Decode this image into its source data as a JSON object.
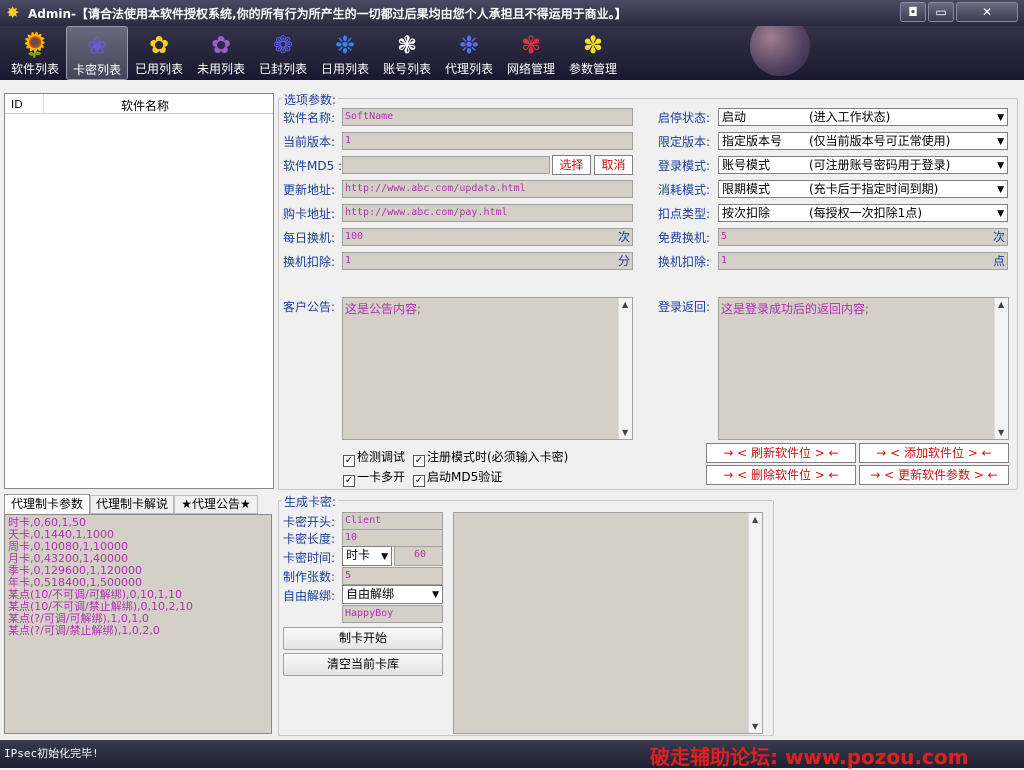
{
  "title": "Admin-【请合法使用本软件授权系统,你的所有行为所产生的一切都过后果均由您个人承担且不得运用于商业。】",
  "window_buttons": {
    "restore": "◘",
    "minimize": "▭",
    "close": "✕"
  },
  "toolbar": [
    {
      "label": "软件列表",
      "icon": "🌻",
      "color": "#f0c030"
    },
    {
      "label": "卡密列表",
      "icon": "❀",
      "color": "#6a5adc"
    },
    {
      "label": "已用列表",
      "icon": "✿",
      "color": "#f5d020"
    },
    {
      "label": "未用列表",
      "icon": "✿",
      "color": "#9a60d0"
    },
    {
      "label": "已封列表",
      "icon": "❁",
      "color": "#5a60e0"
    },
    {
      "label": "日用列表",
      "icon": "❉",
      "color": "#3a80f0"
    },
    {
      "label": "账号列表",
      "icon": "❃",
      "color": "#ffffff"
    },
    {
      "label": "代理列表",
      "icon": "❉",
      "color": "#5a70f0"
    },
    {
      "label": "网络管理",
      "icon": "✾",
      "color": "#e03040"
    },
    {
      "label": "参数管理",
      "icon": "✽",
      "color": "#f0e020"
    }
  ],
  "software_list": {
    "col_id": "ID",
    "col_name": "软件名称"
  },
  "tabs": [
    "代理制卡参数",
    "代理制卡解说",
    "★代理公告★"
  ],
  "agent_params": [
    "时卡,0,60,1,50",
    "天卡,0,1440,1,1000",
    "周卡,0,10080,1,10000",
    "月卡,0,43200,1,40000",
    "季卡,0,129600,1,120000",
    "年卡,0,518400,1,500000",
    "某点(10/不可调/可解绑),0,10,1,10",
    "某点(10/不可调/禁止解绑),0,10,2,10",
    "某点(?/可调/可解绑),1,0,1,0",
    "某点(?/可调/禁止解绑),1,0,2,0"
  ],
  "options": {
    "group_title": "选项参数:",
    "software_name_label": "软件名称:",
    "software_name": "SoftName",
    "version_label": "当前版本:",
    "version": "1",
    "md5_label": "软件MD5 :",
    "md5": "",
    "select_btn": "选择",
    "cancel_btn": "取消",
    "update_url_label": "更新地址:",
    "update_url": "http://www.abc.com/updata.html",
    "buy_url_label": "购卡地址:",
    "buy_url": "http://www.abc.com/pay.html",
    "daily_switch_label": "每日换机:",
    "daily_switch": "100",
    "daily_switch_unit": "次",
    "switch_deduct_label": "换机扣除:",
    "switch_deduct": "1",
    "switch_deduct_unit": "分",
    "status_label": "启停状态:",
    "status_value": "启动",
    "status_desc": "(进入工作状态)",
    "limit_version_label": "限定版本:",
    "limit_version_value": "指定版本号",
    "limit_version_desc": "(仅当前版本号可正常使用)",
    "login_mode_label": "登录模式:",
    "login_mode_value": "账号模式",
    "login_mode_desc": "(可注册账号密码用于登录)",
    "consume_mode_label": "消耗模式:",
    "consume_mode_value": "限期模式",
    "consume_mode_desc": "(充卡后于指定时间到期)",
    "deduct_type_label": "扣点类型:",
    "deduct_type_value": "按次扣除",
    "deduct_type_desc": "(每授权一次扣除1点)",
    "free_switch_label": "免费换机:",
    "free_switch": "5",
    "free_switch_unit": "次",
    "switch_deduct2_label": "换机扣除:",
    "switch_deduct2": "1",
    "switch_deduct2_unit": "点",
    "notice_label": "客户公告:",
    "notice": "这是公告内容;",
    "login_return_label": "登录返回:",
    "login_return": "这是登录成功后的返回内容;",
    "chk_debug": "检测调试",
    "chk_register": "注册模式时(必须输入卡密)",
    "chk_multi": "一卡多开",
    "chk_md5": "启动MD5验证",
    "btn_refresh": "→ <  刷新软件位  > ←",
    "btn_add": "→ <  添加软件位  > ←",
    "btn_delete": "→ <  删除软件位  > ←",
    "btn_update": "→ < 更新软件参数 > ←"
  },
  "gen": {
    "group_title": "生成卡密:",
    "prefix_label": "卡密开头:",
    "prefix": "Client",
    "length_label": "卡密长度:",
    "length": "10",
    "time_label": "卡密时间:",
    "time_unit": "时卡",
    "time_value": "60",
    "count_label": "制作张数:",
    "count": "5",
    "unbind_label": "自由解绑:",
    "unbind_value": "自由解绑",
    "extra": "HappyBoy",
    "btn_start": "制卡开始",
    "btn_clear": "清空当前卡库"
  },
  "status_text": "IPsec初始化完毕!",
  "watermark": "破走辅助论坛: www.pozou.com"
}
